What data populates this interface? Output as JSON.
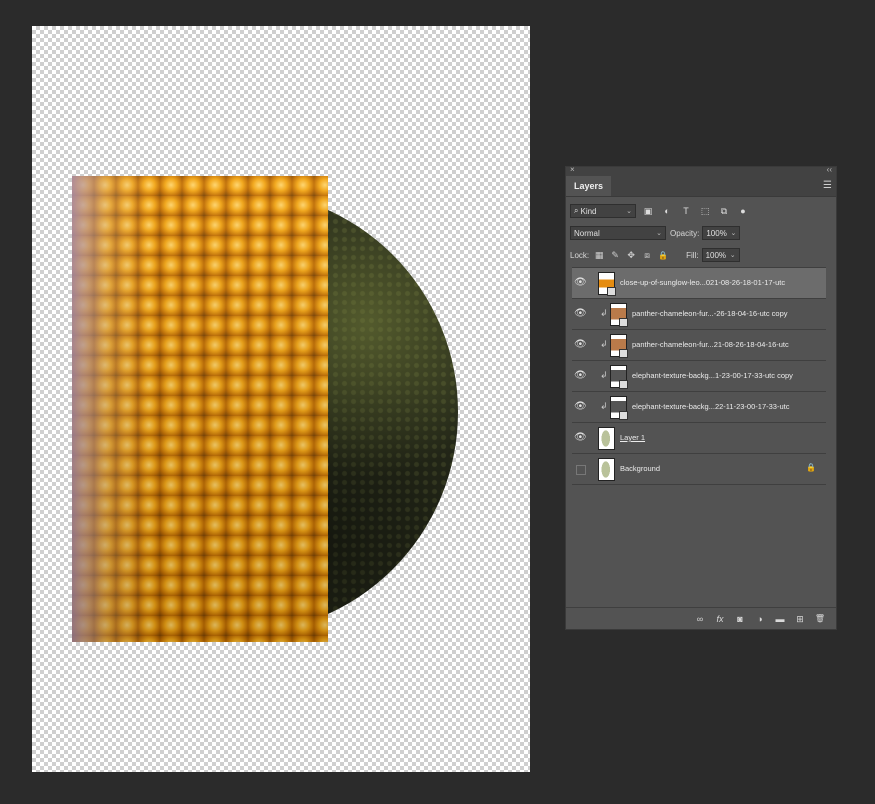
{
  "panel": {
    "close_glyph": "×",
    "collapse_glyph": "‹‹",
    "tab_label": "Layers",
    "menu_glyph": "☰",
    "filter": {
      "kind_label": "Kind",
      "search_glyph": "⌕",
      "icons": [
        {
          "name": "pixel-filter-icon",
          "glyph": "▣"
        },
        {
          "name": "adjustment-filter-icon",
          "glyph": "◐"
        },
        {
          "name": "type-filter-icon",
          "glyph": "T"
        },
        {
          "name": "shape-filter-icon",
          "glyph": "⬚"
        },
        {
          "name": "smart-object-filter-icon",
          "glyph": "⧉"
        },
        {
          "name": "filter-toggle-icon",
          "glyph": "●"
        }
      ]
    },
    "blend_mode": "Normal",
    "opacity_label": "Opacity:",
    "opacity_value": "100%",
    "lock_label": "Lock:",
    "fill_label": "Fill:",
    "fill_value": "100%",
    "lock_icons": [
      {
        "name": "lock-transparent-icon",
        "glyph": "▦"
      },
      {
        "name": "lock-image-icon",
        "glyph": "✎"
      },
      {
        "name": "lock-position-icon",
        "glyph": "✥"
      },
      {
        "name": "lock-artboard-icon",
        "glyph": "⧈"
      },
      {
        "name": "lock-all-icon",
        "glyph": "🔒"
      }
    ],
    "layers": [
      {
        "name": "close-up-of-sunglow-leo...021-08-26-18-01-17-utc",
        "clipped": false,
        "visible": true,
        "selected": true
      },
      {
        "name": "panther-chameleon-fur...-26-18-04-16-utc copy",
        "clipped": true,
        "visible": true,
        "selected": false
      },
      {
        "name": "panther-chameleon-fur...21-08-26-18-04-16-utc",
        "clipped": true,
        "visible": true,
        "selected": false
      },
      {
        "name": "elephant-texture-backg...1-23-00-17-33-utc copy",
        "clipped": true,
        "visible": true,
        "selected": false
      },
      {
        "name": "elephant-texture-backg...22-11-23-00-17-33-utc",
        "clipped": true,
        "visible": true,
        "selected": false
      },
      {
        "name": "Layer 1",
        "clipped": false,
        "visible": true,
        "selected": false
      },
      {
        "name": "Background",
        "clipped": false,
        "visible": false,
        "selected": false
      }
    ],
    "eye_glyph": "👁",
    "clip_glyph": "↲",
    "lock_glyph": "🔒",
    "footer_icons": [
      {
        "name": "link-layers-icon",
        "glyph": "∞"
      },
      {
        "name": "layer-style-icon",
        "glyph": "fx"
      },
      {
        "name": "add-mask-icon",
        "glyph": "◙"
      },
      {
        "name": "adjustment-layer-icon",
        "glyph": "◑"
      },
      {
        "name": "new-group-icon",
        "glyph": "▬"
      },
      {
        "name": "new-layer-icon",
        "glyph": "⊞"
      },
      {
        "name": "delete-layer-icon",
        "glyph": "🗑"
      }
    ]
  }
}
